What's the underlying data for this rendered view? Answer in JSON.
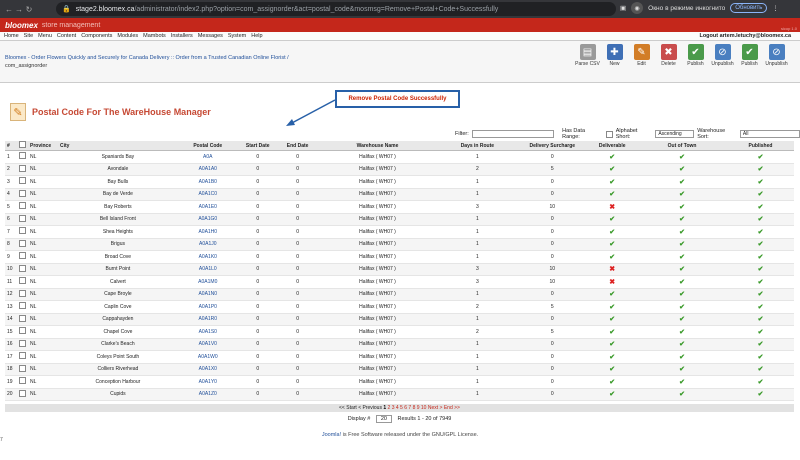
{
  "browser": {
    "url_host": "stage2.bloomex.ca",
    "url_rest": "/administrator/index2.php?option=com_assignorder&act=postal_code&mosmsg=Remove+Postal+Code+Successfully",
    "incognito_label": "Окно в режиме инкогнито",
    "update_label": "Обновить"
  },
  "brand": {
    "logo": "bloomex",
    "tagline": "store management",
    "version": "sicop 1.0"
  },
  "menu": {
    "items": [
      "Home",
      "Site",
      "Menu",
      "Content",
      "Components",
      "Modules",
      "Mambots",
      "Installers",
      "Messages",
      "System",
      "Help"
    ],
    "logout": "Logout artem.letuchy@bloomex.ca"
  },
  "breadcrumb": {
    "link": "Bloomex - Order Flowers Quickly and Securely for Canada Delivery :: Order from a Trusted Canadian Online Florist /",
    "plain": "com_assignorder"
  },
  "toolbar": [
    {
      "label": "Parse CSV",
      "icon": "csv-icon",
      "color": "#9a9a9a"
    },
    {
      "label": "New",
      "icon": "new-icon",
      "color": "#3f6fb5"
    },
    {
      "label": "Edit",
      "icon": "edit-icon",
      "color": "#d27d27"
    },
    {
      "label": "Delete",
      "icon": "delete-icon",
      "color": "#c94c4c"
    },
    {
      "label": "Publish",
      "icon": "publish-icon",
      "color": "#4a9a4a"
    },
    {
      "label": "Unpublish",
      "icon": "unpublish-icon",
      "color": "#4a7fc0"
    },
    {
      "label": "Publish",
      "icon": "publish-icon",
      "color": "#4a9a4a"
    },
    {
      "label": "Unpublish",
      "icon": "unpublish-icon",
      "color": "#4a7fc0"
    }
  ],
  "page": {
    "title": "Postal Code For The WareHouse Manager"
  },
  "message": "Remove Postal Code Successfully",
  "filters": {
    "filter_label": "Filter:",
    "filter_value": "",
    "date_range_label": "Has Data Range:",
    "alpha_label": "Alphabet Short:",
    "alpha_value": "Ascending",
    "warehouse_label": "Warehouse Sort:",
    "warehouse_value": "All"
  },
  "columns": [
    "#",
    "",
    "Province",
    "City",
    "Postal Code",
    "Start Date",
    "End Date",
    "Warehouse Name",
    "Days in Route",
    "Delivery Surcharge",
    "Deliverable",
    "Out of Town",
    "Published"
  ],
  "rows": [
    {
      "n": "1",
      "prov": "NL",
      "city": "Spaniards Bay",
      "pc": "A0A",
      "sd": "0",
      "ed": "0",
      "wh": "Halifax ( WH07 )",
      "days": "1",
      "sur": "0",
      "del": true
    },
    {
      "n": "2",
      "prov": "NL",
      "city": "Avondale",
      "pc": "A0A1A0",
      "sd": "0",
      "ed": "0",
      "wh": "Halifax ( WH07 )",
      "days": "2",
      "sur": "5",
      "del": true
    },
    {
      "n": "3",
      "prov": "NL",
      "city": "Bay Bulls",
      "pc": "A0A1B0",
      "sd": "0",
      "ed": "0",
      "wh": "Halifax ( WH07 )",
      "days": "1",
      "sur": "0",
      "del": true
    },
    {
      "n": "4",
      "prov": "NL",
      "city": "Bay de Verde",
      "pc": "A0A1C0",
      "sd": "0",
      "ed": "0",
      "wh": "Halifax ( WH07 )",
      "days": "1",
      "sur": "0",
      "del": true
    },
    {
      "n": "5",
      "prov": "NL",
      "city": "Bay Roberts",
      "pc": "A0A1E0",
      "sd": "0",
      "ed": "0",
      "wh": "Halifax ( WH07 )",
      "days": "3",
      "sur": "10",
      "del": false
    },
    {
      "n": "6",
      "prov": "NL",
      "city": "Bell Island Front",
      "pc": "A0A1G0",
      "sd": "0",
      "ed": "0",
      "wh": "Halifax ( WH07 )",
      "days": "1",
      "sur": "0",
      "del": true
    },
    {
      "n": "7",
      "prov": "NL",
      "city": "Shea Heights",
      "pc": "A0A1H0",
      "sd": "0",
      "ed": "0",
      "wh": "Halifax ( WH07 )",
      "days": "1",
      "sur": "0",
      "del": true
    },
    {
      "n": "8",
      "prov": "NL",
      "city": "Brigus",
      "pc": "A0A1J0",
      "sd": "0",
      "ed": "0",
      "wh": "Halifax ( WH07 )",
      "days": "1",
      "sur": "0",
      "del": true
    },
    {
      "n": "9",
      "prov": "NL",
      "city": "Broad Cove",
      "pc": "A0A1K0",
      "sd": "0",
      "ed": "0",
      "wh": "Halifax ( WH07 )",
      "days": "1",
      "sur": "0",
      "del": true
    },
    {
      "n": "10",
      "prov": "NL",
      "city": "Burnt Point",
      "pc": "A0A1L0",
      "sd": "0",
      "ed": "0",
      "wh": "Halifax ( WH07 )",
      "days": "3",
      "sur": "10",
      "del": false
    },
    {
      "n": "11",
      "prov": "NL",
      "city": "Calvert",
      "pc": "A0A1M0",
      "sd": "0",
      "ed": "0",
      "wh": "Halifax ( WH07 )",
      "days": "3",
      "sur": "10",
      "del": false
    },
    {
      "n": "12",
      "prov": "NL",
      "city": "Cape Broyle",
      "pc": "A0A1N0",
      "sd": "0",
      "ed": "0",
      "wh": "Halifax ( WH07 )",
      "days": "1",
      "sur": "0",
      "del": true
    },
    {
      "n": "13",
      "prov": "NL",
      "city": "Caplin Cove",
      "pc": "A0A1P0",
      "sd": "0",
      "ed": "0",
      "wh": "Halifax ( WH07 )",
      "days": "2",
      "sur": "5",
      "del": true
    },
    {
      "n": "14",
      "prov": "NL",
      "city": "Cappahayden",
      "pc": "A0A1R0",
      "sd": "0",
      "ed": "0",
      "wh": "Halifax ( WH07 )",
      "days": "1",
      "sur": "0",
      "del": true
    },
    {
      "n": "15",
      "prov": "NL",
      "city": "Chapel Cove",
      "pc": "A0A1S0",
      "sd": "0",
      "ed": "0",
      "wh": "Halifax ( WH07 )",
      "days": "2",
      "sur": "5",
      "del": true
    },
    {
      "n": "16",
      "prov": "NL",
      "city": "Clarke's Beach",
      "pc": "A0A1V0",
      "sd": "0",
      "ed": "0",
      "wh": "Halifax ( WH07 )",
      "days": "1",
      "sur": "0",
      "del": true
    },
    {
      "n": "17",
      "prov": "NL",
      "city": "Coleys Point South",
      "pc": "A0A1W0",
      "sd": "0",
      "ed": "0",
      "wh": "Halifax ( WH07 )",
      "days": "1",
      "sur": "0",
      "del": true
    },
    {
      "n": "18",
      "prov": "NL",
      "city": "Colliers Riverhead",
      "pc": "A0A1X0",
      "sd": "0",
      "ed": "0",
      "wh": "Halifax ( WH07 )",
      "days": "1",
      "sur": "0",
      "del": true
    },
    {
      "n": "19",
      "prov": "NL",
      "city": "Conception Harbour",
      "pc": "A0A1Y0",
      "sd": "0",
      "ed": "0",
      "wh": "Halifax ( WH07 )",
      "days": "1",
      "sur": "0",
      "del": true
    },
    {
      "n": "20",
      "prov": "NL",
      "city": "Cupids",
      "pc": "A0A1Z0",
      "sd": "0",
      "ed": "0",
      "wh": "Halifax ( WH07 )",
      "days": "1",
      "sur": "0",
      "del": true
    }
  ],
  "pagination": {
    "start_prev": "<< Start < Previous",
    "current": "1",
    "pages": [
      "2",
      "3",
      "4",
      "5",
      "6",
      "7",
      "8",
      "9",
      "10"
    ],
    "next_end": "Next > End >>"
  },
  "display": {
    "label": "Display #",
    "value": "20",
    "results": "Results 1 - 20 of 7949"
  },
  "footer": {
    "link": "Joomla!",
    "text": " is Free Software released under the GNU/GPL License."
  },
  "edge_text": "7"
}
